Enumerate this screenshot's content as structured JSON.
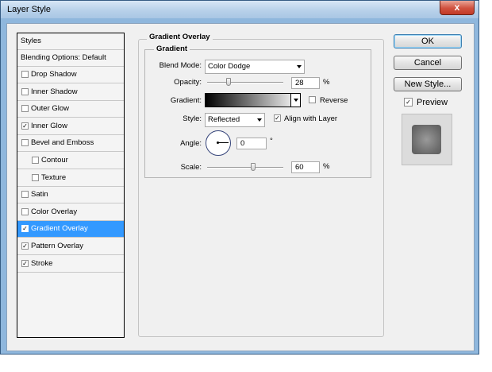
{
  "window": {
    "title": "Layer Style",
    "close_glyph": "x"
  },
  "styles_list": {
    "header": "Styles",
    "blending": "Blending Options: Default",
    "items": [
      {
        "label": "Drop Shadow",
        "checked": false,
        "sub": false,
        "selected": false
      },
      {
        "label": "Inner Shadow",
        "checked": false,
        "sub": false,
        "selected": false
      },
      {
        "label": "Outer Glow",
        "checked": false,
        "sub": false,
        "selected": false
      },
      {
        "label": "Inner Glow",
        "checked": true,
        "sub": false,
        "selected": false
      },
      {
        "label": "Bevel and Emboss",
        "checked": false,
        "sub": false,
        "selected": false
      },
      {
        "label": "Contour",
        "checked": false,
        "sub": true,
        "selected": false
      },
      {
        "label": "Texture",
        "checked": false,
        "sub": true,
        "selected": false
      },
      {
        "label": "Satin",
        "checked": false,
        "sub": false,
        "selected": false
      },
      {
        "label": "Color Overlay",
        "checked": false,
        "sub": false,
        "selected": false
      },
      {
        "label": "Gradient Overlay",
        "checked": true,
        "sub": false,
        "selected": true
      },
      {
        "label": "Pattern Overlay",
        "checked": true,
        "sub": false,
        "selected": false
      },
      {
        "label": "Stroke",
        "checked": true,
        "sub": false,
        "selected": false
      }
    ]
  },
  "panel": {
    "title": "Gradient Overlay",
    "group_title": "Gradient",
    "blend_mode": {
      "label": "Blend Mode:",
      "value": "Color Dodge"
    },
    "opacity": {
      "label": "Opacity:",
      "value": "28",
      "unit": "%",
      "level": 0.28
    },
    "gradient": {
      "label": "Gradient:",
      "reverse_label": "Reverse",
      "reverse_checked": false
    },
    "style": {
      "label": "Style:",
      "value": "Reflected",
      "align_label": "Align with Layer",
      "align_checked": true
    },
    "angle": {
      "label": "Angle:",
      "value": "0",
      "unit": "°"
    },
    "scale": {
      "label": "Scale:",
      "value": "60",
      "unit": "%",
      "level": 0.6
    }
  },
  "buttons": {
    "ok": "OK",
    "cancel": "Cancel",
    "new_style": "New Style...",
    "preview_label": "Preview",
    "preview_checked": true
  },
  "colors": {
    "selection": "#3399ff",
    "title_bar": "#b8d1ea",
    "close_button": "#c23a27"
  }
}
